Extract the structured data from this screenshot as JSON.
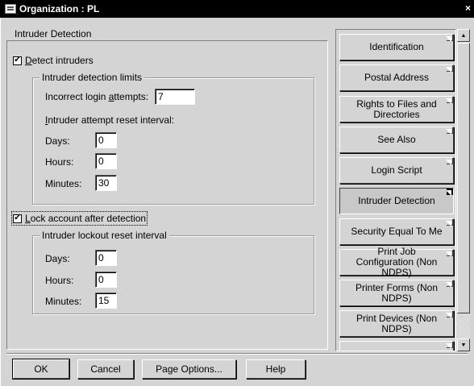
{
  "window": {
    "title": "Organization : PL",
    "close_glyph": "×"
  },
  "page": {
    "heading": "Intruder Detection"
  },
  "detect": {
    "checked": true,
    "label_first": "D",
    "label_rest": "etect intruders",
    "group_title": "Intruder detection limits",
    "login_attempts_label_pre": "Incorrect login ",
    "login_attempts_label_ul": "a",
    "login_attempts_label_post": "ttempts:",
    "login_attempts_value": "7",
    "reset_interval_label_pre": "I",
    "reset_interval_label_post": "ntruder attempt reset interval:",
    "days_label": "Days:",
    "days_value": "0",
    "hours_label": "Hours:",
    "hours_value": "0",
    "minutes_label": "Minutes:",
    "minutes_value": "30"
  },
  "lock": {
    "checked": true,
    "label_first": "L",
    "label_rest": "ock account after detection",
    "group_title": "Intruder lockout reset interval",
    "days_label": "Days:",
    "days_value": "0",
    "hours_label": "Hours:",
    "hours_value": "0",
    "minutes_label": "Minutes:",
    "minutes_value": "15"
  },
  "tabs": [
    {
      "label": "Identification",
      "active": false
    },
    {
      "label": "Postal Address",
      "active": false
    },
    {
      "label": "Rights to Files and Directories",
      "active": false
    },
    {
      "label": "See Also",
      "active": false
    },
    {
      "label": "Login Script",
      "active": false
    },
    {
      "label": "Intruder Detection",
      "active": true
    },
    {
      "label": "Security Equal To Me",
      "active": false
    },
    {
      "label": "Print Job Configuration (Non NDPS)",
      "active": false
    },
    {
      "label": "Printer Forms (Non NDPS)",
      "active": false
    },
    {
      "label": "Print Devices (Non NDPS)",
      "active": false
    },
    {
      "label": "",
      "active": false
    }
  ],
  "buttons": {
    "ok": "OK",
    "cancel": "Cancel",
    "page_options": "Page Options...",
    "help": "Help"
  },
  "icons": {
    "app": "organization-icon",
    "close": "close-icon",
    "check": "checkmark-icon",
    "scroll_up": "scroll-up-arrow-icon",
    "scroll_down": "scroll-down-arrow-icon"
  }
}
